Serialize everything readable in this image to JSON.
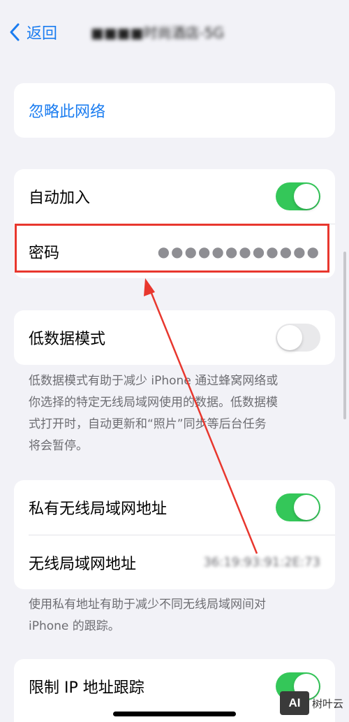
{
  "nav": {
    "back_label": "返回",
    "title": "■■■■时尚酒店-5G"
  },
  "forget": {
    "label": "忽略此网络"
  },
  "group1": {
    "auto_join_label": "自动加入",
    "auto_join_on": true,
    "password_label": "密码",
    "password_mask": "●●●●●●●●●●●●"
  },
  "low_data": {
    "label": "低数据模式",
    "on": false,
    "note_lines": [
      "低数据模式有助于减少 iPhone 通过蜂窝网络或",
      "你选择的特定无线局域网使用的数据。低数据模",
      "式打开时，自动更新和“照片”同步等后台任务",
      "将会暂停。"
    ]
  },
  "private_addr": {
    "label": "私有无线局域网地址",
    "on": true,
    "wifi_addr_label": "无线局域网地址",
    "wifi_addr_value": "36:19:93:91:2E:73",
    "note_lines": [
      "使用私有地址有助于减少不同无线局域网间对",
      "iPhone 的跟踪。"
    ]
  },
  "limit_ip": {
    "label": "限制 IP 地址跟踪",
    "on": true
  },
  "watermark": {
    "logo": "AI",
    "text": "树叶云"
  },
  "colors": {
    "accent": "#1a7cf0",
    "toggle_on": "#34c759",
    "highlight": "#e8372e",
    "background": "#f2f2f7"
  }
}
